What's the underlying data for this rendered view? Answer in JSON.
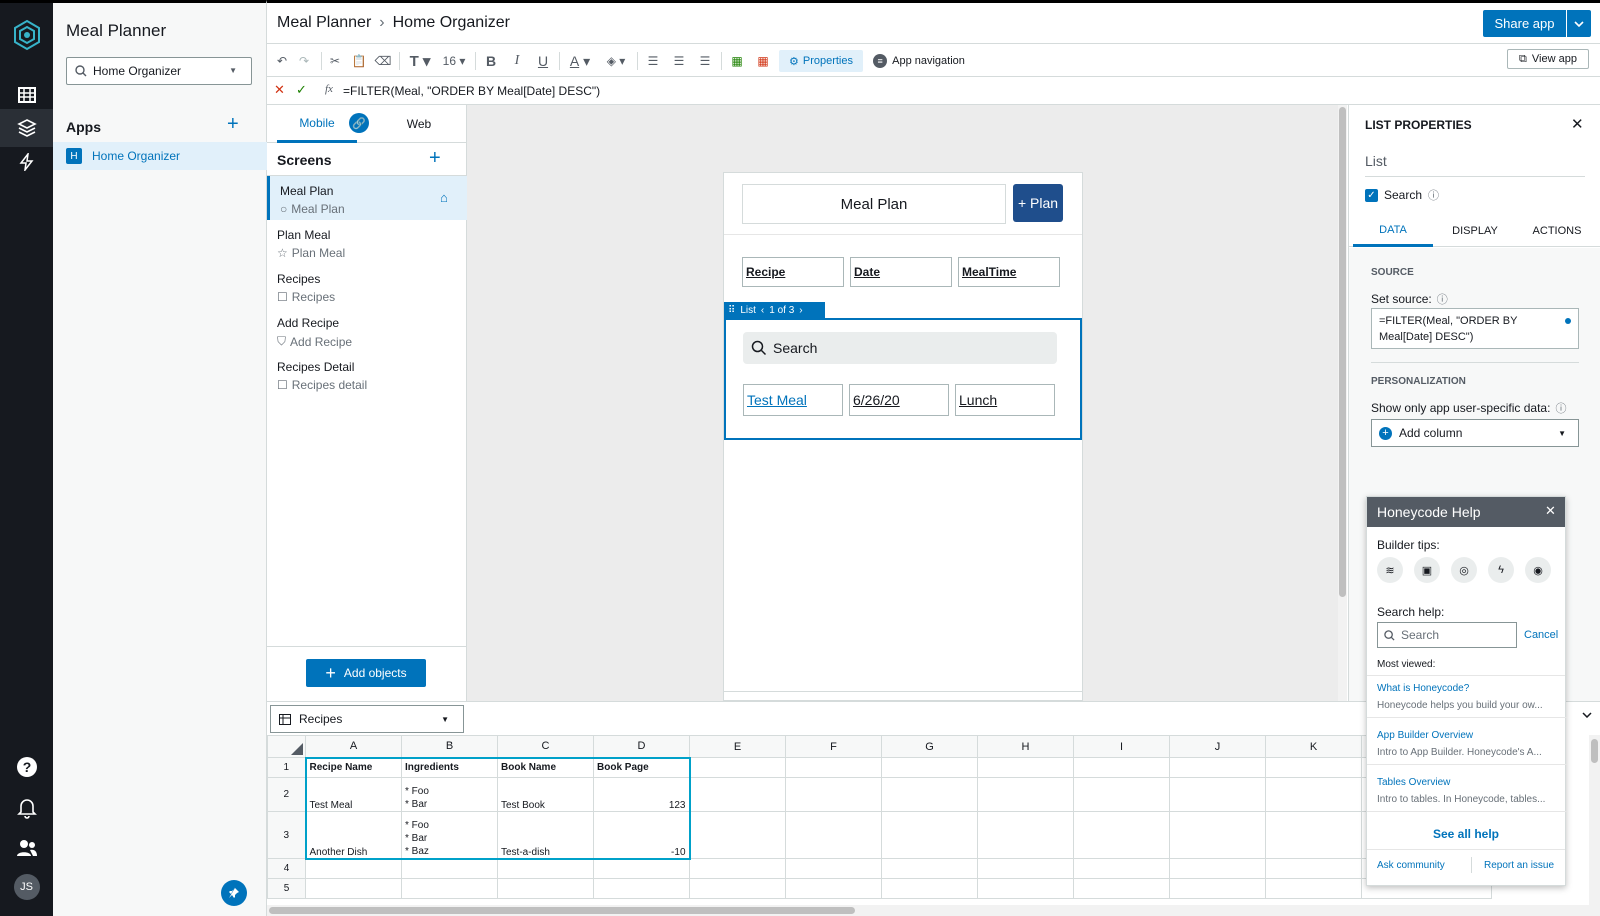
{
  "app": {
    "title": "Meal Planner",
    "crumb": "Home Organizer",
    "workspace": "Home Organizer",
    "apps_heading": "Apps",
    "app_item": "Home Organizer",
    "app_badge": "H",
    "user_initials": "JS"
  },
  "topbar": {
    "share_label": "Share app",
    "view_label": "View app"
  },
  "toolbar": {
    "font_size": "16",
    "properties_label": "Properties",
    "nav_label": "App navigation"
  },
  "formula": {
    "fx": "fx",
    "value": "=FILTER(Meal, \"ORDER BY Meal[Date] DESC\")"
  },
  "screens": {
    "tab_mobile": "Mobile",
    "tab_web": "Web",
    "heading": "Screens",
    "add_objects": "Add objects",
    "items": [
      {
        "title": "Meal Plan",
        "sub": "Meal Plan"
      },
      {
        "title": "Plan Meal",
        "sub": "Plan Meal"
      },
      {
        "title": "Recipes",
        "sub": "Recipes"
      },
      {
        "title": "Add Recipe",
        "sub": "Add Recipe"
      },
      {
        "title": "Recipes Detail",
        "sub": "Recipes detail"
      }
    ]
  },
  "phone": {
    "title": "Meal Plan",
    "plan_btn": "+ Plan",
    "headers": [
      "Recipe",
      "Date",
      "MealTime"
    ],
    "list_label": "List",
    "pager": "1 of 3",
    "search": "Search",
    "row": [
      "Test Meal",
      "6/26/20",
      "Lunch"
    ]
  },
  "props": {
    "heading": "LIST PROPERTIES",
    "name": "List",
    "search_label": "Search",
    "tabs": [
      "DATA",
      "DISPLAY",
      "ACTIONS"
    ],
    "source_heading": "SOURCE",
    "set_source": "Set source:",
    "source_value": "=FILTER(Meal, \"ORDER BY Meal[Date] DESC\")",
    "personal_heading": "PERSONALIZATION",
    "show_only": "Show only app user-specific data:",
    "add_column": "Add column"
  },
  "help": {
    "title": "Honeycode Help",
    "tips": "Builder tips:",
    "search_help": "Search help:",
    "search_ph": "Search",
    "cancel": "Cancel",
    "most_viewed": "Most viewed:",
    "links": [
      {
        "t": "What is Honeycode?",
        "d": "Honeycode helps you build your ow..."
      },
      {
        "t": "App Builder Overview",
        "d": "Intro to App Builder. Honeycode's A..."
      },
      {
        "t": "Tables Overview",
        "d": "Intro to tables. In Honeycode, tables..."
      }
    ],
    "see_all": "See all help",
    "community": "Ask community",
    "report": "Report an issue"
  },
  "sheet": {
    "table_select": "Recipes",
    "cols": [
      "A",
      "B",
      "C",
      "D",
      "E",
      "F",
      "G",
      "H",
      "I",
      "J",
      "K"
    ],
    "rows": [
      "1",
      "2",
      "3",
      "4",
      "5"
    ],
    "header": [
      "Recipe Name",
      "Ingredients",
      "Book Name",
      "Book Page"
    ],
    "r2": {
      "name": "Test Meal",
      "ing1": "* Foo",
      "ing2": "* Bar",
      "book": "Test Book",
      "page": "123"
    },
    "r3": {
      "name": "Another Dish",
      "ing1": "* Foo",
      "ing2": "* Bar",
      "ing3": "* Baz",
      "book": "Test-a-dish",
      "page": "-10"
    }
  },
  "colors": {
    "accent": "#0073bb",
    "rail": "#16191f",
    "selection": "#00a1c9"
  }
}
